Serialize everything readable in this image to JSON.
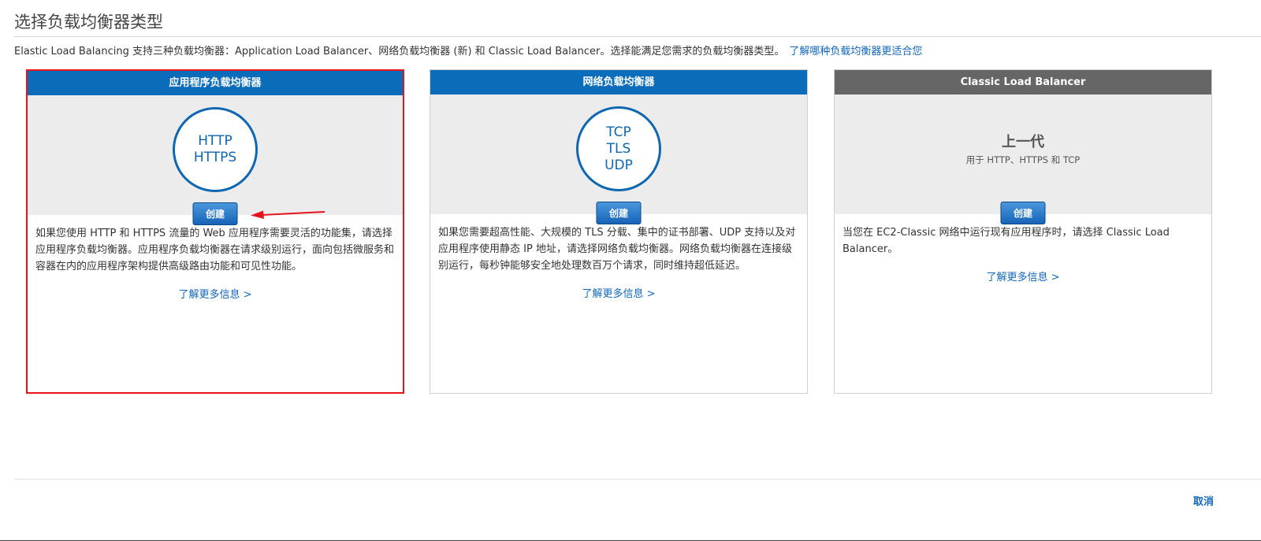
{
  "page": {
    "title": "选择负载均衡器类型",
    "intro_text": "Elastic Load Balancing 支持三种负载均衡器：Application Load Balancer、网络负载均衡器 (新) 和 Classic Load Balancer。选择能满足您需求的负载均衡器类型。",
    "intro_link": "了解哪种负载均衡器更适合您"
  },
  "cards": [
    {
      "header": "应用程序负载均衡器",
      "protocols": [
        "HTTP",
        "HTTPS"
      ],
      "create_label": "创建",
      "description": "如果您使用 HTTP 和 HTTPS 流量的 Web 应用程序需要灵活的功能集，请选择应用程序负载均衡器。应用程序负载均衡器在请求级别运行，面向包括微服务和容器在内的应用程序架构提供高级路由功能和可见性功能。",
      "learn_more": "了解更多信息 >"
    },
    {
      "header": "网络负载均衡器",
      "protocols": [
        "TCP",
        "TLS",
        "UDP"
      ],
      "create_label": "创建",
      "description": "如果您需要超高性能、大规模的 TLS 分载、集中的证书部署、UDP 支持以及对应用程序使用静态 IP 地址，请选择网络负载均衡器。网络负载均衡器在连接级别运行，每秒钟能够安全地处理数百万个请求，同时维持超低延迟。",
      "learn_more": "了解更多信息 >"
    },
    {
      "header": "Classic Load Balancer",
      "generation_title": "上一代",
      "generation_sub": "用于 HTTP、HTTPS 和 TCP",
      "create_label": "创建",
      "description": "当您在 EC2-Classic 网络中运行现有应用程序时，请选择 Classic Load Balancer。",
      "learn_more": "了解更多信息 >"
    }
  ],
  "footer": {
    "cancel_label": "取消"
  },
  "colors": {
    "header_blue": "#0b6cba",
    "header_gray": "#666666",
    "link": "#1166bb",
    "selection_border": "#e8141c",
    "annotation_arrow": "#e8141c"
  },
  "icons": {
    "annotation": "red-arrow-icon"
  }
}
